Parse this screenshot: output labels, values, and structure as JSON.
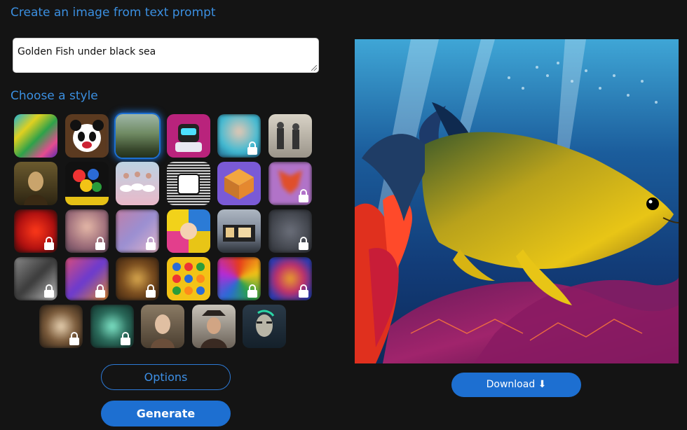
{
  "prompt_section": {
    "heading": "Create an image from text prompt",
    "prompt_value": "Golden Fish under black sea"
  },
  "style_section": {
    "heading": "Choose a style",
    "styles": [
      {
        "icon": "abstract-paint-style",
        "locked": false
      },
      {
        "icon": "panda-style",
        "locked": false
      },
      {
        "icon": "landscape-painting-style",
        "locked": false,
        "selected": true
      },
      {
        "icon": "robot-style",
        "locked": false
      },
      {
        "icon": "anime-girl-style",
        "locked": true
      },
      {
        "icon": "vintage-photo-style",
        "locked": false
      },
      {
        "icon": "renaissance-portrait-style",
        "locked": false
      },
      {
        "icon": "flower-bouquet-style",
        "locked": false
      },
      {
        "icon": "ballet-dancers-style",
        "locked": false
      },
      {
        "icon": "engraving-cup-style",
        "locked": false
      },
      {
        "icon": "isometric-3d-style",
        "locked": false
      },
      {
        "icon": "fox-style",
        "locked": true
      },
      {
        "icon": "red-neon-style",
        "locked": true
      },
      {
        "icon": "portrait-woman-style",
        "locked": true
      },
      {
        "icon": "pastel-portrait-style",
        "locked": true
      },
      {
        "icon": "pop-art-style",
        "locked": false
      },
      {
        "icon": "modern-house-style",
        "locked": false
      },
      {
        "icon": "dark-creature-style",
        "locked": true
      },
      {
        "icon": "monochrome-city-style",
        "locked": true
      },
      {
        "icon": "fantasy-figure-style",
        "locked": true
      },
      {
        "icon": "golden-ornament-style",
        "locked": true
      },
      {
        "icon": "flat-icons-style",
        "locked": false
      },
      {
        "icon": "psychedelic-swirl-style",
        "locked": true
      },
      {
        "icon": "colorful-mask-style",
        "locked": true
      },
      {
        "icon": "warrior-style",
        "locked": true
      },
      {
        "icon": "teal-forest-style",
        "locked": true
      },
      {
        "icon": "classic-lady-portrait-style",
        "locked": false
      },
      {
        "icon": "pirate-portrait-style",
        "locked": false
      },
      {
        "icon": "cyborg-face-style",
        "locked": false
      }
    ]
  },
  "actions": {
    "options_label": "Options",
    "generate_label": "Generate",
    "download_label": "Download ⬇"
  },
  "result": {
    "icon": "golden-fish-image"
  },
  "colors": {
    "accent": "#1d6fd1",
    "heading": "#3b8fe0",
    "background": "#141414"
  }
}
